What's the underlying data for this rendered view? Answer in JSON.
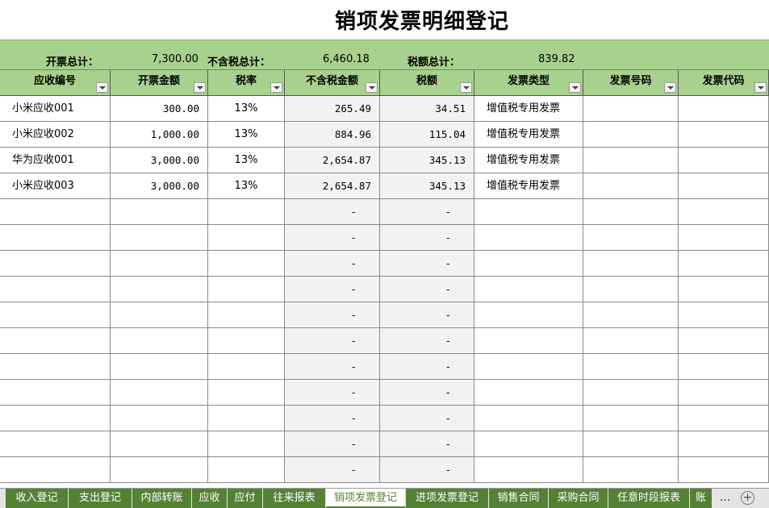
{
  "title": "销项发票明细登记",
  "summary": {
    "total_invoice_label": "开票总计：",
    "total_invoice_value": "7,300.00",
    "total_excl_tax_label": "不含税总计：",
    "total_excl_tax_value": "6,460.18",
    "total_tax_label": "税额总计：",
    "total_tax_value": "839.82"
  },
  "columns": [
    "应收编号",
    "开票金额",
    "税率",
    "不含税金额",
    "税额",
    "发票类型",
    "发票号码",
    "发票代码"
  ],
  "rows": [
    {
      "id": "小米应收001",
      "amount": "300.00",
      "rate": "13%",
      "excl": "265.49",
      "tax": "34.51",
      "type": "增值税专用发票",
      "number": "",
      "code": ""
    },
    {
      "id": "小米应收002",
      "amount": "1,000.00",
      "rate": "13%",
      "excl": "884.96",
      "tax": "115.04",
      "type": "增值税专用发票",
      "number": "",
      "code": ""
    },
    {
      "id": "华为应收001",
      "amount": "3,000.00",
      "rate": "13%",
      "excl": "2,654.87",
      "tax": "345.13",
      "type": "增值税专用发票",
      "number": "",
      "code": ""
    },
    {
      "id": "小米应收003",
      "amount": "3,000.00",
      "rate": "13%",
      "excl": "2,654.87",
      "tax": "345.13",
      "type": "增值税专用发票",
      "number": "",
      "code": ""
    },
    {
      "id": "",
      "amount": "",
      "rate": "",
      "excl": "-",
      "tax": "-",
      "type": "",
      "number": "",
      "code": ""
    },
    {
      "id": "",
      "amount": "",
      "rate": "",
      "excl": "-",
      "tax": "-",
      "type": "",
      "number": "",
      "code": ""
    },
    {
      "id": "",
      "amount": "",
      "rate": "",
      "excl": "-",
      "tax": "-",
      "type": "",
      "number": "",
      "code": ""
    },
    {
      "id": "",
      "amount": "",
      "rate": "",
      "excl": "-",
      "tax": "-",
      "type": "",
      "number": "",
      "code": ""
    },
    {
      "id": "",
      "amount": "",
      "rate": "",
      "excl": "-",
      "tax": "-",
      "type": "",
      "number": "",
      "code": ""
    },
    {
      "id": "",
      "amount": "",
      "rate": "",
      "excl": "-",
      "tax": "-",
      "type": "",
      "number": "",
      "code": ""
    },
    {
      "id": "",
      "amount": "",
      "rate": "",
      "excl": "-",
      "tax": "-",
      "type": "",
      "number": "",
      "code": ""
    },
    {
      "id": "",
      "amount": "",
      "rate": "",
      "excl": "-",
      "tax": "-",
      "type": "",
      "number": "",
      "code": ""
    },
    {
      "id": "",
      "amount": "",
      "rate": "",
      "excl": "-",
      "tax": "-",
      "type": "",
      "number": "",
      "code": ""
    },
    {
      "id": "",
      "amount": "",
      "rate": "",
      "excl": "-",
      "tax": "-",
      "type": "",
      "number": "",
      "code": ""
    },
    {
      "id": "",
      "amount": "",
      "rate": "",
      "excl": "-",
      "tax": "-",
      "type": "",
      "number": "",
      "code": ""
    }
  ],
  "tabs": [
    {
      "label": "收入登记",
      "active": false
    },
    {
      "label": "支出登记",
      "active": false
    },
    {
      "label": "内部转账",
      "active": false
    },
    {
      "label": "应收",
      "active": false
    },
    {
      "label": "应付",
      "active": false
    },
    {
      "label": "往来报表",
      "active": false
    },
    {
      "label": "销项发票登记",
      "active": true
    },
    {
      "label": "进项发票登记",
      "active": false
    },
    {
      "label": "销售合同",
      "active": false
    },
    {
      "label": "采购合同",
      "active": false
    },
    {
      "label": "任意时段报表",
      "active": false
    },
    {
      "label": "账",
      "active": false
    }
  ],
  "tab_more": "...",
  "add_sheet_icon": "plus-circle-icon",
  "colors": {
    "header_green": "#a9d18e",
    "tab_green": "#548235",
    "calc_gray": "#f2f2f2"
  }
}
